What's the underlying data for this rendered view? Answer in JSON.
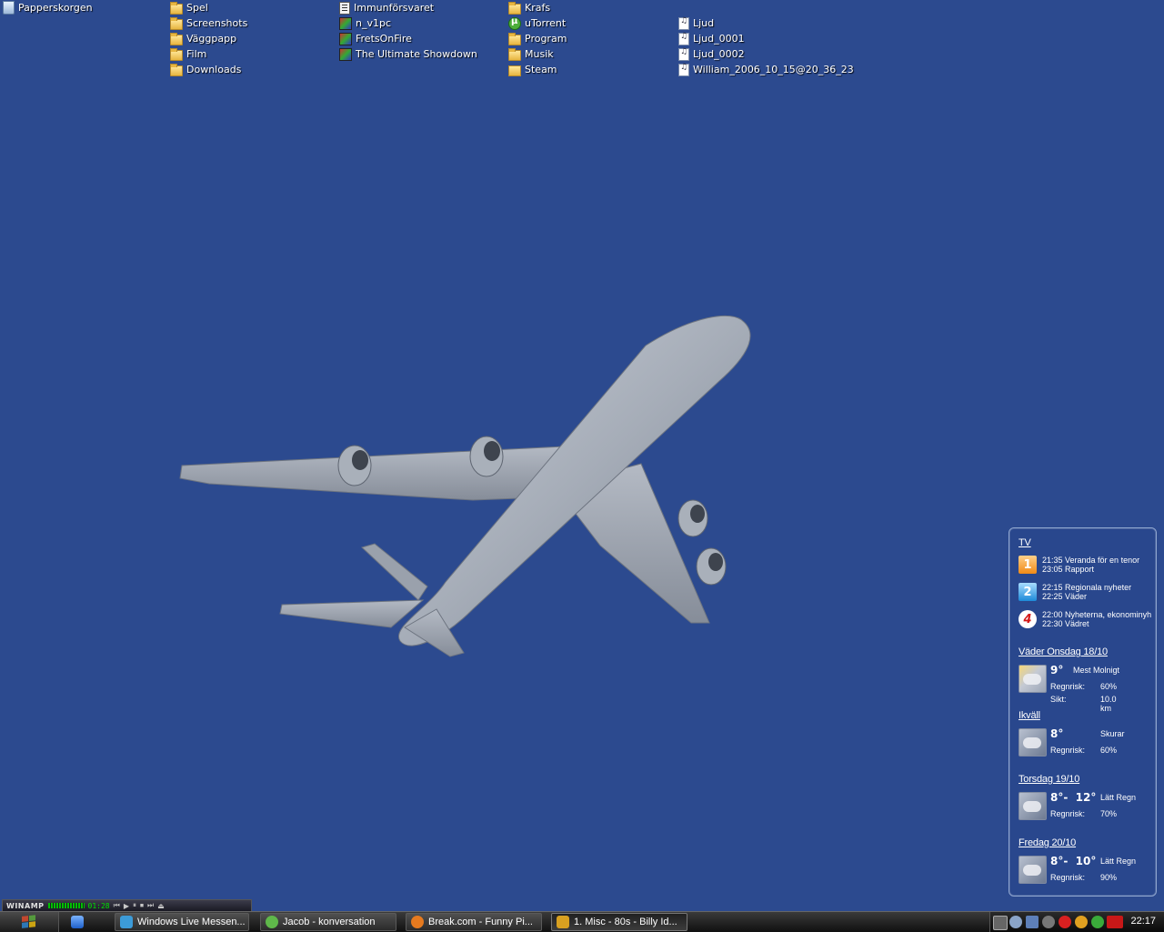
{
  "desktop": {
    "background_color": "#2c4a8f",
    "icons": [
      {
        "label": "Papperskorgen",
        "icon": "recycle-bin-icon"
      },
      {
        "label": "Spel",
        "icon": "folder-icon"
      },
      {
        "label": "Screenshots",
        "icon": "folder-icon"
      },
      {
        "label": "Väggpapp",
        "icon": "folder-icon"
      },
      {
        "label": "Film",
        "icon": "folder-icon"
      },
      {
        "label": "Downloads",
        "icon": "folder-icon"
      },
      {
        "label": "Immunförsvaret",
        "icon": "document-icon"
      },
      {
        "label": "n_v1pc",
        "icon": "application-icon"
      },
      {
        "label": "FretsOnFire",
        "icon": "application-icon"
      },
      {
        "label": "The Ultimate Showdown",
        "icon": "application-icon"
      },
      {
        "label": "Krafs",
        "icon": "folder-icon"
      },
      {
        "label": "uTorrent",
        "icon": "utorrent-icon"
      },
      {
        "label": "Program",
        "icon": "folder-icon"
      },
      {
        "label": "Musik",
        "icon": "folder-icon"
      },
      {
        "label": "Steam",
        "icon": "folder-icon"
      },
      {
        "label": "Ljud",
        "icon": "audio-file-icon"
      },
      {
        "label": "Ljud_0001",
        "icon": "audio-file-icon"
      },
      {
        "label": "Ljud_0002",
        "icon": "audio-file-icon"
      },
      {
        "label": "William_2006_10_15@20_36_23",
        "icon": "audio-file-icon"
      }
    ]
  },
  "widget": {
    "tv": {
      "heading": "TV",
      "channels": [
        {
          "logo": "1",
          "line1": "21:35 Veranda för en tenor",
          "line2": "23:05 Rapport"
        },
        {
          "logo": "2",
          "line1": "22:15 Regionala nyheter",
          "line2": "22:25 Väder"
        },
        {
          "logo": "4",
          "line1": "22:00 Nyheterna, ekonominyh",
          "line2": "22:30 Vädret"
        }
      ]
    },
    "weather": {
      "today_heading": "Väder Onsdag 18/10",
      "today": {
        "temp": "9°",
        "desc": "Mest Molnigt",
        "rain_label": "Regnrisk:",
        "rain": "60%",
        "vis_label": "Sikt:",
        "vis": "10.0 km"
      },
      "evening_heading": "Ikväll",
      "evening": {
        "temp": "8°",
        "desc": "Skurar",
        "rain_label": "Regnrisk:",
        "rain": "60%"
      },
      "thu_heading": "Torsdag 19/10",
      "thu": {
        "temp": "8°-  12°",
        "desc": "Lätt Regn",
        "rain_label": "Regnrisk:",
        "rain": "70%"
      },
      "fri_heading": "Fredag 20/10",
      "fri": {
        "temp": "8°-  10°",
        "desc": "Lätt Regn",
        "rain_label": "Regnrisk:",
        "rain": "90%"
      }
    }
  },
  "winamp": {
    "title": "WINAMP",
    "time": "01:28",
    "buttons": [
      "⏮",
      "▶",
      "⏸",
      "⏹",
      "⏭",
      "⏏"
    ]
  },
  "taskbar": {
    "tasks": [
      {
        "label": "Windows Live Messen...",
        "icon": "messenger-icon",
        "color": "#3c9bd8"
      },
      {
        "label": "Jacob - konversation",
        "icon": "messenger-contact-icon",
        "color": "#5fb84a"
      },
      {
        "label": "Break.com - Funny Pi...",
        "icon": "firefox-icon",
        "color": "#e67a1f"
      },
      {
        "label": "1. Misc - 80s - Billy Id...",
        "icon": "winamp-icon",
        "color": "#d8a020"
      }
    ],
    "clock": "22:17"
  }
}
